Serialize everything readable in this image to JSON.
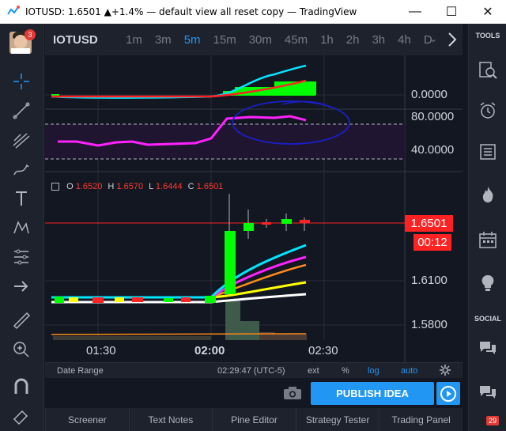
{
  "window": {
    "title": "IOTUSD: 1.6501 ▲+1.4% — default view all reset copy — TradingView",
    "minimize": "—",
    "maximize": "☐",
    "close": "✕"
  },
  "user": {
    "notifications": "3"
  },
  "header": {
    "symbol": "IOTUSD",
    "timeframes": [
      "1m",
      "3m",
      "5m",
      "15m",
      "30m",
      "45m",
      "1h",
      "2h",
      "3h",
      "4h",
      "D"
    ],
    "active_timeframe": "5m",
    "more": "⌄"
  },
  "right_panel": {
    "tools_label": "TOOLS",
    "social_label": "SOCIAL",
    "chat_badge": "29"
  },
  "chart": {
    "ohlc": {
      "o_label": "O",
      "o": "1.6520",
      "h_label": "H",
      "h": "1.6570",
      "l_label": "L",
      "l": "1.6444",
      "c_label": "C",
      "c": "1.6501"
    },
    "price_axis": {
      "indicator1": [
        "0.0000"
      ],
      "indicator2": [
        "80.0000",
        "40.0000"
      ],
      "main": [
        "1.6100",
        "1.5800"
      ]
    },
    "last_price": "1.6501",
    "countdown": "00:12",
    "time_labels": [
      "01:30",
      "02:00",
      "02:30"
    ],
    "colors": {
      "up": "#00ff00",
      "down": "#ff2222",
      "rsi": "#ff22ff",
      "annotation": "#1a1fc9",
      "accent": "#2196f3"
    }
  },
  "statusbar": {
    "date_range": "Date Range",
    "time": "02:29:47 (UTC-5)",
    "ext": "ext",
    "percent": "%",
    "log": "log",
    "auto": "auto"
  },
  "publish": {
    "label": "PUBLISH IDEA"
  },
  "bottom_tabs": [
    "Screener",
    "Text Notes",
    "Pine Editor",
    "Strategy Tester",
    "Trading Panel"
  ]
}
